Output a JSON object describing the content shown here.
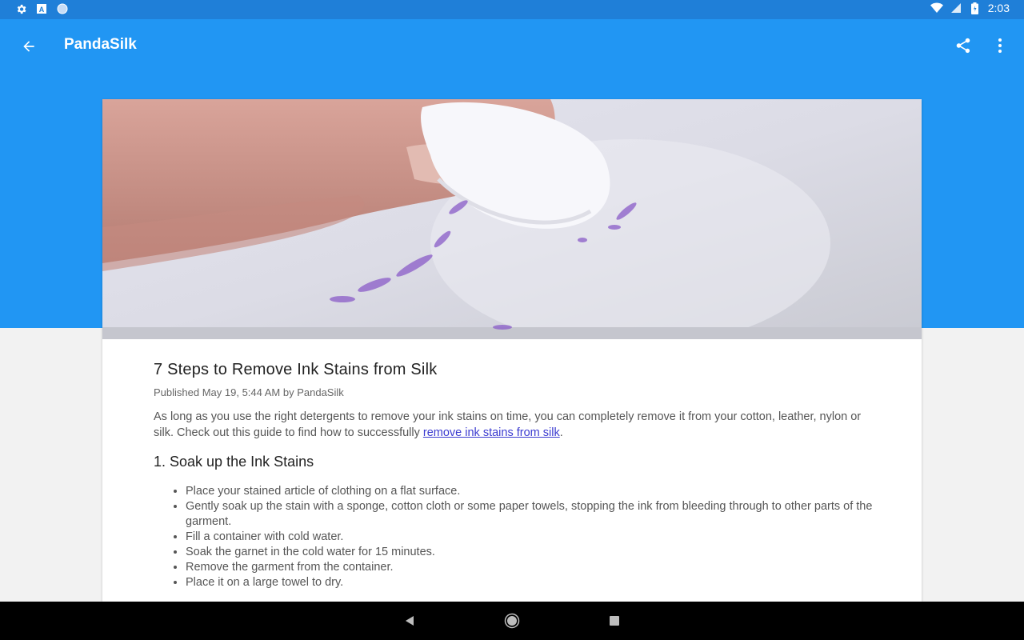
{
  "status_bar": {
    "time": "2:03",
    "left_icons": [
      "gear-icon",
      "a-icon",
      "circle-icon"
    ],
    "right_icons": [
      "wifi-icon",
      "signal-icon",
      "battery-icon"
    ]
  },
  "app_bar": {
    "title": "PandaSilk",
    "color": "#2196f3"
  },
  "article": {
    "title": "7 Steps to Remove Ink Stains from Silk",
    "meta": "Published May 19, 5:44 AM by PandaSilk",
    "intro_before": "As long as you use the right detergents to remove your ink stains on time, you can completely remove it from your cotton, leather, nylon or silk. Check out this guide to find how to successfully ",
    "intro_link": "remove ink stains from silk",
    "intro_after": ".",
    "section_title": "1. Soak up the Ink Stains",
    "steps": [
      "Place your stained article of clothing on a flat surface.",
      "Gently soak up the stain with a sponge, cotton cloth or some paper towels, stopping the ink from bleeding through to other parts of the garment.",
      "Fill a container with cold water.",
      "Soak the garnet in the cold water for 15 minutes.",
      "Remove the garment from the container.",
      "Place it on a large towel to dry."
    ]
  }
}
